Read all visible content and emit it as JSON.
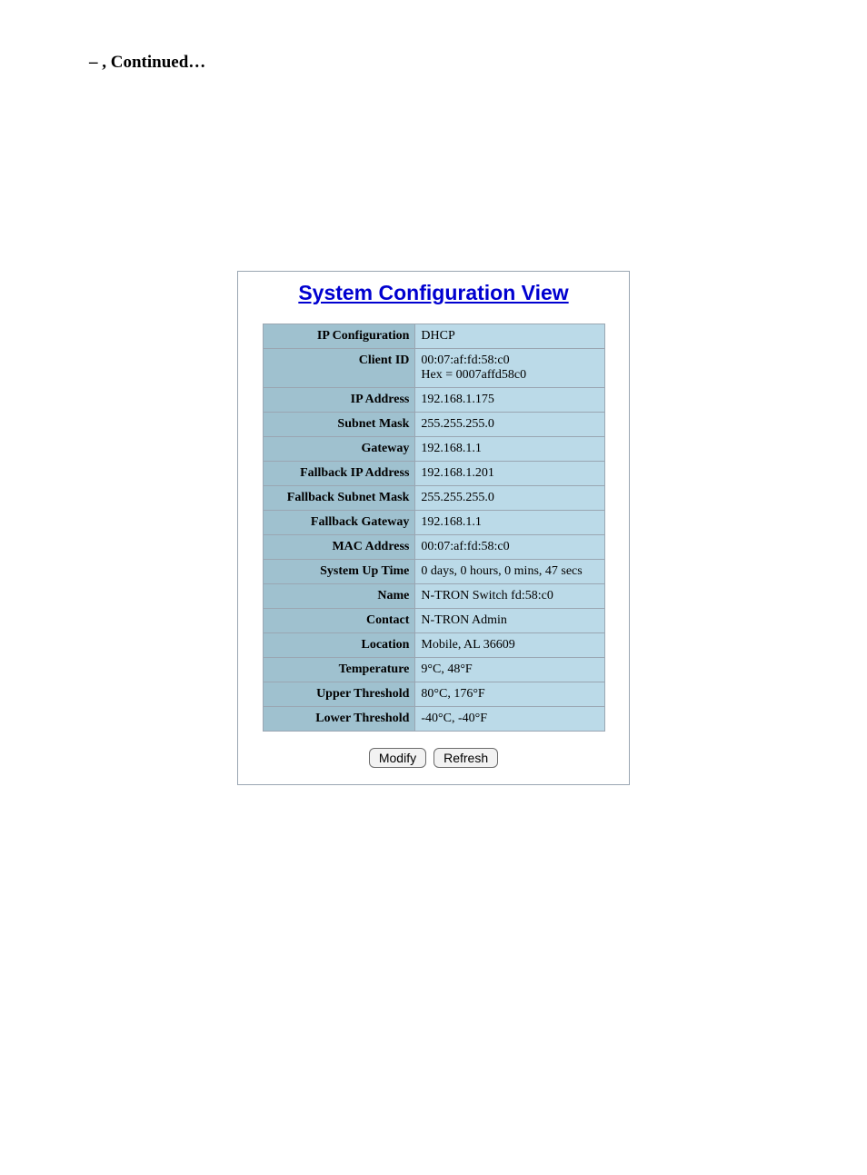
{
  "heading": "–          , Continued…",
  "panel_title": "System Configuration View",
  "rows": [
    {
      "label": "IP Configuration",
      "value": "DHCP"
    },
    {
      "label": "Client ID",
      "value": "00:07:af:fd:58:c0\nHex = 0007affd58c0"
    },
    {
      "label": "IP Address",
      "value": "192.168.1.175"
    },
    {
      "label": "Subnet Mask",
      "value": "255.255.255.0"
    },
    {
      "label": "Gateway",
      "value": "192.168.1.1"
    },
    {
      "label": "Fallback IP Address",
      "value": "192.168.1.201"
    },
    {
      "label": "Fallback Subnet Mask",
      "value": "255.255.255.0"
    },
    {
      "label": "Fallback Gateway",
      "value": "192.168.1.1"
    },
    {
      "label": "MAC Address",
      "value": "00:07:af:fd:58:c0"
    },
    {
      "label": "System Up Time",
      "value": "0 days, 0 hours, 0 mins, 47 secs"
    },
    {
      "label": "Name",
      "value": "N-TRON Switch fd:58:c0"
    },
    {
      "label": "Contact",
      "value": "N-TRON Admin"
    },
    {
      "label": "Location",
      "value": "Mobile, AL 36609"
    },
    {
      "label": "Temperature",
      "value": "9°C, 48°F"
    },
    {
      "label": "Upper Threshold",
      "value": "80°C, 176°F"
    },
    {
      "label": "Lower Threshold",
      "value": "-40°C, -40°F"
    }
  ],
  "buttons": {
    "modify": "Modify",
    "refresh": "Refresh"
  }
}
